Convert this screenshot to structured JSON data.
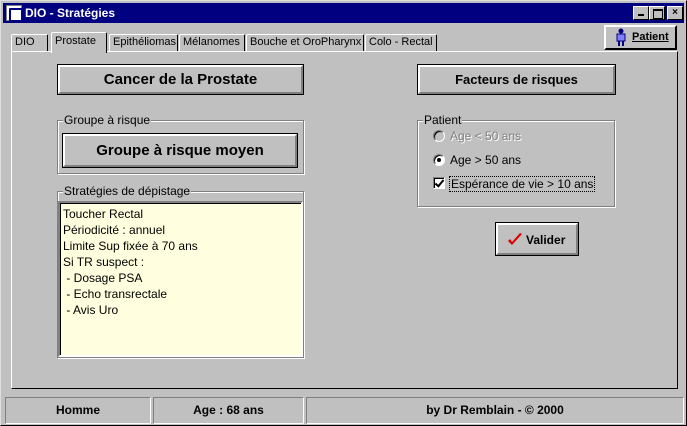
{
  "window": {
    "title": "DIO - Stratégies",
    "controls": {
      "minimize_icon": "minimize-icon",
      "maximize_icon": "maximize-icon",
      "close_label": "×"
    }
  },
  "tabs": [
    {
      "label": "DIO",
      "active": false
    },
    {
      "label": "Prostate",
      "active": true
    },
    {
      "label": "Epithéliomas",
      "active": false
    },
    {
      "label": "Mélanomes",
      "active": false
    },
    {
      "label": "Bouche et OroPharynx",
      "active": false
    },
    {
      "label": "Colo - Rectal",
      "active": false
    }
  ],
  "patient_button": {
    "label": "Patient",
    "icon": "person-icon"
  },
  "left": {
    "title": "Cancer de la Prostate",
    "risk_group": {
      "label": "Groupe à risque",
      "value": "Groupe à risque moyen"
    },
    "strategies": {
      "label": "Stratégies de dépistage",
      "lines": [
        "Toucher Rectal",
        "Périodicité : annuel",
        "Limite Sup fixée à 70 ans",
        "Si TR suspect :",
        " - Dosage PSA",
        " - Echo transrectale",
        " - Avis Uro"
      ]
    }
  },
  "right": {
    "title": "Facteurs de risques",
    "patient_group": {
      "label": "Patient",
      "radios": [
        {
          "label": "Age < 50 ans",
          "checked": false,
          "disabled": true
        },
        {
          "label": "Age > 50 ans",
          "checked": true,
          "disabled": false
        }
      ],
      "checkbox": {
        "label": "Espérance de vie > 10 ans",
        "checked": true
      }
    },
    "valider": {
      "label": "Valider",
      "icon": "checkmark-icon",
      "icon_color": "#e00000"
    }
  },
  "statusbar": {
    "sex": "Homme",
    "age": "Age : 68 ans",
    "credit": "by Dr Remblain - © 2000"
  },
  "colors": {
    "titlebar": "#000080",
    "memo_bg": "#ffffe0",
    "face": "#c0c0c0"
  }
}
